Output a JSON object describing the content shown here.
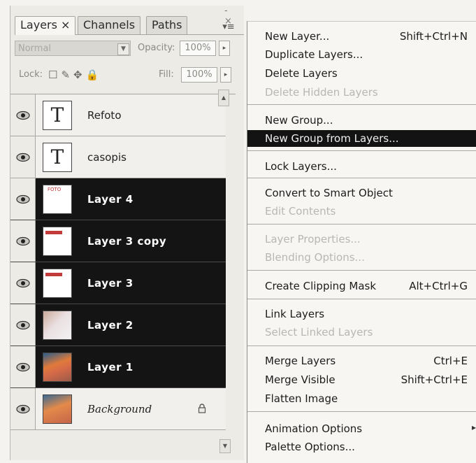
{
  "panel": {
    "tabs": [
      "Layers ×",
      "Channels",
      "Paths"
    ],
    "window_controls": "- ×",
    "menu_glyph": "▾≡",
    "blend_mode": "Normal",
    "opacity_label": "Opacity:",
    "opacity_value": "100%",
    "lock_label": "Lock:",
    "fill_label": "Fill:",
    "fill_value": "100%",
    "layers": [
      {
        "name": "Refoto",
        "selected": false,
        "thumb": "T"
      },
      {
        "name": "casopis",
        "selected": false,
        "thumb": "T"
      },
      {
        "name": "Layer 4",
        "selected": true,
        "thumb_text": "FOTO"
      },
      {
        "name": "Layer 3 copy",
        "selected": true
      },
      {
        "name": "Layer 3",
        "selected": true
      },
      {
        "name": "Layer 2",
        "selected": true
      },
      {
        "name": "Layer 1",
        "selected": true
      },
      {
        "name": "Background",
        "selected": false,
        "locked": true
      }
    ]
  },
  "menu": {
    "items": [
      {
        "label": "New Layer...",
        "shortcut": "Shift+Ctrl+N",
        "enabled": true
      },
      {
        "label": "Duplicate Layers...",
        "enabled": true
      },
      {
        "label": "Delete Layers",
        "enabled": true
      },
      {
        "label": "Delete Hidden Layers",
        "enabled": false
      },
      {
        "label": "New Group...",
        "enabled": true
      },
      {
        "label": "New Group from Layers...",
        "enabled": true,
        "highlighted": true
      },
      {
        "label": "Lock Layers...",
        "enabled": true
      },
      {
        "label": "Convert to Smart Object",
        "enabled": true
      },
      {
        "label": "Edit Contents",
        "enabled": false
      },
      {
        "label": "Layer Properties...",
        "enabled": false
      },
      {
        "label": "Blending Options...",
        "enabled": false
      },
      {
        "label": "Create Clipping Mask",
        "shortcut": "Alt+Ctrl+G",
        "enabled": true
      },
      {
        "label": "Link Layers",
        "enabled": true
      },
      {
        "label": "Select Linked Layers",
        "enabled": false
      },
      {
        "label": "Merge Layers",
        "shortcut": "Ctrl+E",
        "enabled": true
      },
      {
        "label": "Merge Visible",
        "shortcut": "Shift+Ctrl+E",
        "enabled": true
      },
      {
        "label": "Flatten Image",
        "enabled": true
      },
      {
        "label": "Animation Options",
        "enabled": true,
        "submenu": true
      },
      {
        "label": "Palette Options...",
        "enabled": true
      }
    ],
    "submenu_glyph": "▸"
  },
  "colors": {
    "selection": "#141414",
    "panel_bg": "#ecebe6",
    "menu_bg": "#f7f6f2",
    "disabled_text": "#b8b7b2"
  }
}
